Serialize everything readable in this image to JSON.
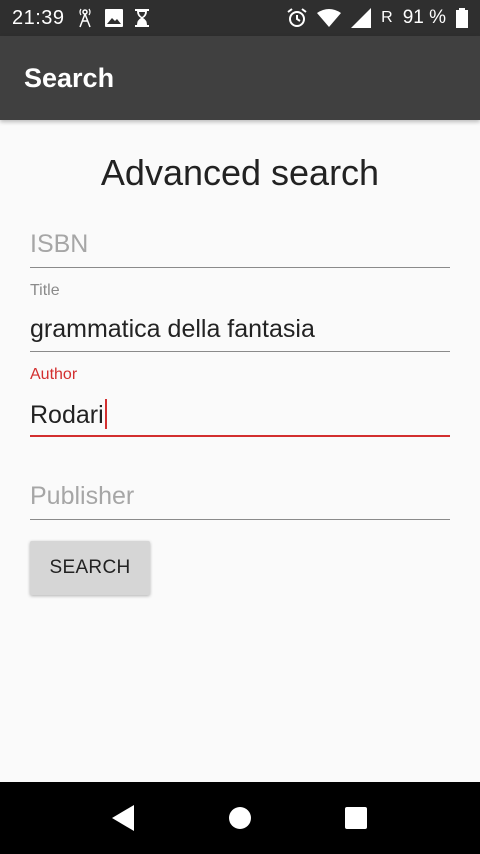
{
  "status_bar": {
    "time": "21:39",
    "left_icons": [
      "signal-tower-icon",
      "image-icon",
      "hourglass-icon"
    ],
    "right_icons": [
      "alarm-icon",
      "wifi-icon",
      "cell-signal-icon"
    ],
    "roaming": "R",
    "battery": "91 %"
  },
  "app_bar": {
    "title": "Search"
  },
  "form": {
    "heading": "Advanced search",
    "isbn": {
      "placeholder": "ISBN",
      "value": ""
    },
    "title": {
      "label": "Title",
      "value": "grammatica della fantasia"
    },
    "author": {
      "label": "Author",
      "value": "Rodari"
    },
    "publisher": {
      "placeholder": "Publisher",
      "value": ""
    },
    "search_button": "SEARCH"
  },
  "colors": {
    "accent": "#d32f2f",
    "app_bar": "#404040",
    "status_bar": "#2f2f2f",
    "background": "#fafafa"
  },
  "nav_bar": {
    "buttons": [
      "back-icon",
      "home-icon",
      "recents-icon"
    ]
  }
}
